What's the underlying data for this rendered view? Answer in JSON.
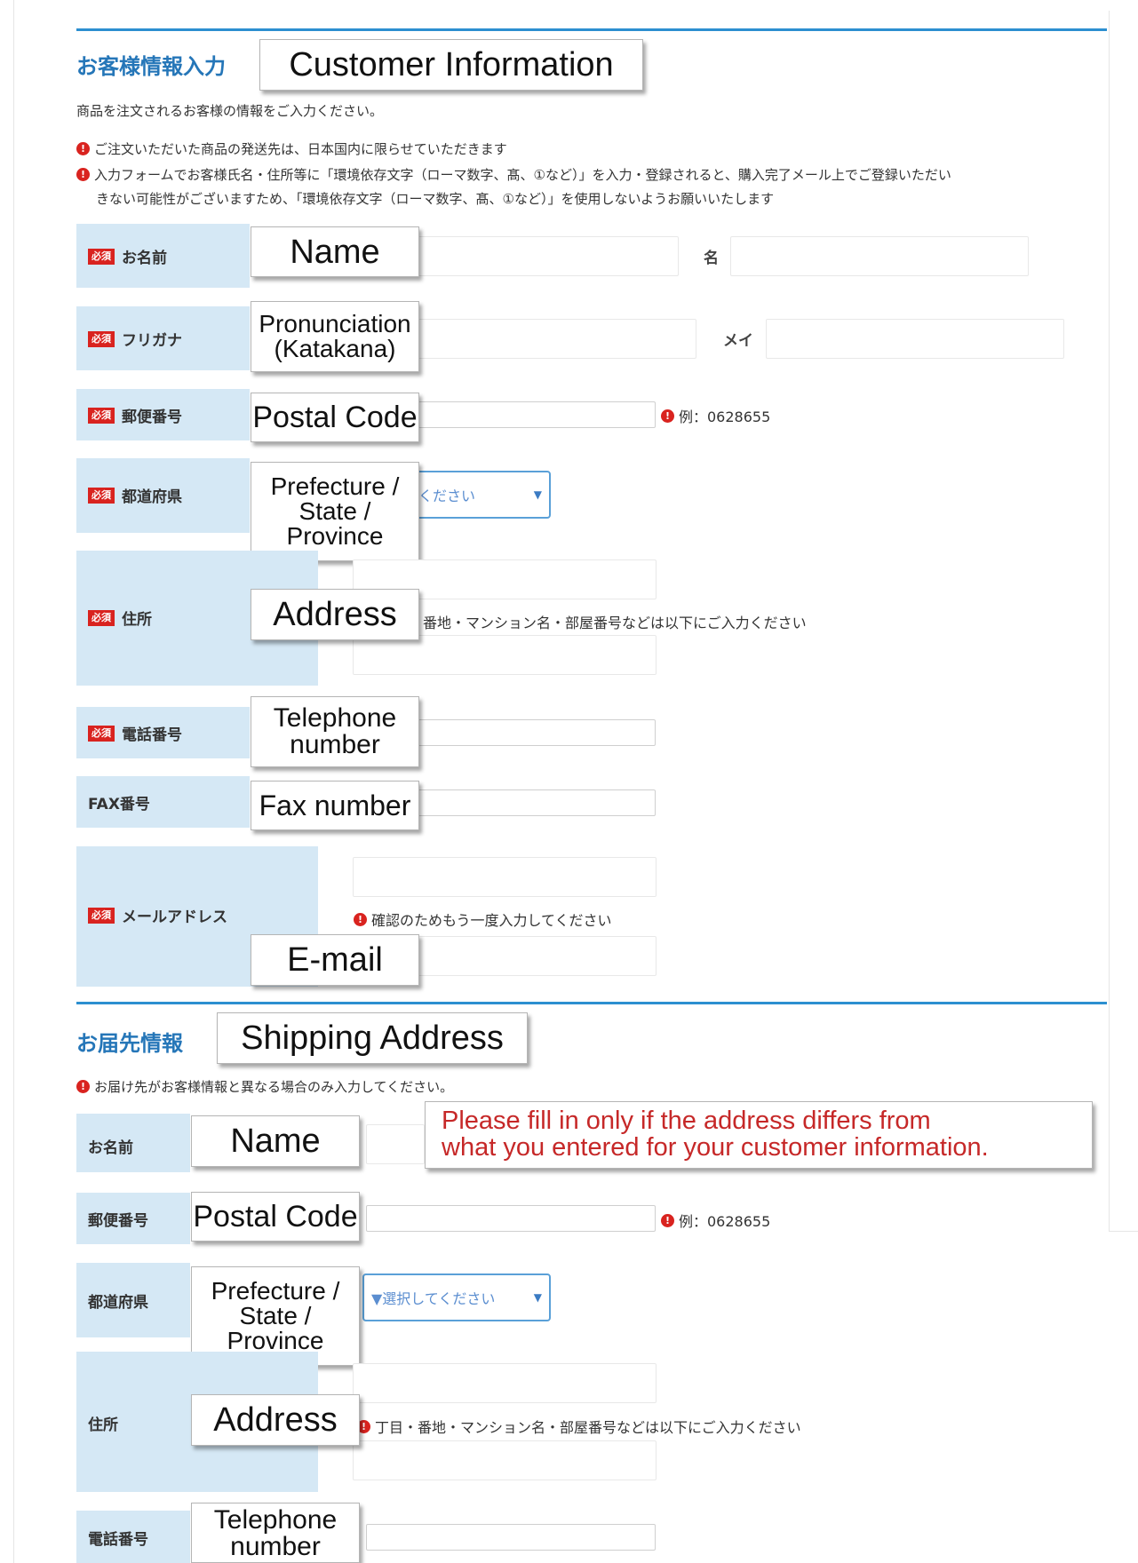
{
  "customer": {
    "title_jp": "お客様情報入力",
    "title_en": "Customer Information",
    "intro": "商品を注文されるお客様の情報をご入力ください。",
    "notes": [
      "ご注文いただいた商品の発送先は、日本国内に限らせていただきます",
      "入力フォームでお客様氏名・住所等に「環境依存文字（ローマ数字、髙、①など）」を入力・登録されると、購入完了メール上でご登録いただい",
      "きない可能性がございますため、「環境依存文字（ローマ数字、髙、①など）」を使用しないようお願いいたします"
    ],
    "required_badge": "必須",
    "name": {
      "label_jp": "お名前",
      "label_en": "Name",
      "first_label": "名"
    },
    "kana": {
      "label_jp": "フリガナ",
      "label_en": "Pronunciation\n(Katakana)",
      "first_label": "メイ"
    },
    "postal": {
      "label_jp": "郵便番号",
      "label_en": "Postal Code",
      "hint": "例：0628655"
    },
    "prefecture": {
      "label_jp": "都道府県",
      "label_en": "Prefecture /\nState /\nProvince",
      "select_value": "択してください"
    },
    "address": {
      "label_jp": "住所",
      "label_en": "Address",
      "hint": "番地・マンション名・部屋番号などは以下にご入力ください"
    },
    "phone": {
      "label_jp": "電話番号",
      "label_en": "Telephone\nnumber"
    },
    "fax": {
      "label_jp": "FAX番号",
      "label_en": "Fax number"
    },
    "email": {
      "label_jp": "メールアドレス",
      "label_en": "E-mail",
      "hint": "確認のためもう一度入力してください"
    }
  },
  "shipping": {
    "title_jp": "お届先情報",
    "title_en": "Shipping Address",
    "note": "お届け先がお客様情報と異なる場合のみ入力してください。",
    "note_en": "Please fill in only if the address differs from\nwhat you entered for your customer information.",
    "name": {
      "label_jp": "お名前",
      "label_en": "Name"
    },
    "postal": {
      "label_jp": "郵便番号",
      "label_en": "Postal Code",
      "hint": "例：0628655"
    },
    "prefecture": {
      "label_jp": "都道府県",
      "label_en": "Prefecture /\nState /\nProvince",
      "select_value": "▼選択してください"
    },
    "address": {
      "label_jp": "住所",
      "label_en": "Address",
      "hint": "丁目・番地・マンション名・部屋番号などは以下にご入力ください"
    },
    "phone": {
      "label_jp": "電話番号",
      "label_en": "Telephone\nnumber"
    }
  },
  "icons": {
    "warning": "exclamation-circle-icon",
    "dropdown": "triangle-down-icon"
  },
  "colors": {
    "accent": "#2c8fd0",
    "label_bg": "#d5e8f5",
    "required": "#d9231f",
    "callout_text_red": "#c62828"
  }
}
